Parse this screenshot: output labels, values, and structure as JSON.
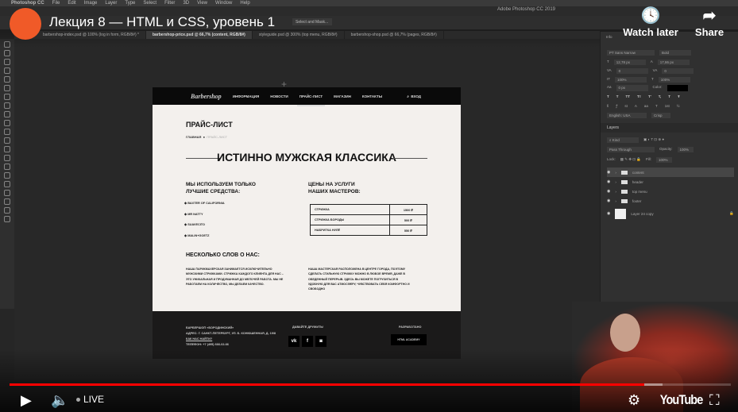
{
  "video": {
    "title": "Лекция 8 — HTML и CSS, уровень 1",
    "watch_later": "Watch later",
    "share": "Share",
    "live": "LIVE",
    "logo": "YouTube",
    "progress_percent": 88,
    "accent": "#ff0000",
    "avatar_color": "#f05a28"
  },
  "mac_menu": [
    "Photoshop CC",
    "File",
    "Edit",
    "Image",
    "Layer",
    "Type",
    "Select",
    "Filter",
    "3D",
    "View",
    "Window",
    "Help"
  ],
  "photoshop": {
    "app_title": "Adobe Photoshop CC 2019",
    "select_mask": "Select and Mask...",
    "tabs": [
      {
        "label": "barbershop-index.psd @ 100% (log in form, RGB/8#) *",
        "active": false
      },
      {
        "label": "barbershop-price.psd @ 66,7% (content, RGB/8#)",
        "active": true
      },
      {
        "label": "styleguide.psd @ 300% (top menu, RGB/8#)",
        "active": false
      },
      {
        "label": "barbershop-shop.psd @ 66,7% (pages, RGB/8#)",
        "active": false
      }
    ],
    "character": {
      "font": "PT Sans Narrow",
      "style": "Bold",
      "size": "12,78 px",
      "leading": "17,86 px",
      "kerning": "0",
      "tracking": "0",
      "vscale": "100%",
      "hscale": "100%",
      "baseline": "0 px",
      "color_label": "Color:",
      "language": "English: USA",
      "aa": "Crisp",
      "panel": "Info"
    },
    "layers": {
      "title": "Layers",
      "filter": "Kind",
      "blend": "Pass Through",
      "opacity_label": "Opacity:",
      "opacity": "100%",
      "lock_label": "Lock:",
      "fill_label": "Fill:",
      "fill": "100%",
      "items": [
        {
          "name": "content",
          "type": "folder",
          "selected": true
        },
        {
          "name": "header",
          "type": "folder"
        },
        {
          "name": "top menu",
          "type": "folder"
        },
        {
          "name": "footer",
          "type": "folder"
        },
        {
          "name": "Layer 24 copy",
          "type": "layer",
          "locked": true
        }
      ]
    }
  },
  "site": {
    "logo": "Barbershop",
    "nav": [
      {
        "label": "ИНФОРМАЦИЯ"
      },
      {
        "label": "НОВОСТИ"
      },
      {
        "label": "ПРАЙС-ЛИСТ",
        "active": true
      },
      {
        "label": "МАГАЗИН"
      },
      {
        "label": "КОНТАКТЫ"
      }
    ],
    "login": "ВХОД",
    "page_title": "ПРАЙС-ЛИСТ",
    "breadcrumb": [
      "ГЛАВНАЯ",
      "ПРАЙС-ЛИСТ"
    ],
    "headline": "ИСТИННО МУЖСКАЯ КЛАССИКА",
    "tools_title": [
      "МЫ ИСПОЛЬЗУЕМ ТОЛЬКО",
      "ЛУЧШИЕ СРЕДСТВА:"
    ],
    "tools": [
      "BAXTER OF CALIFORNIA",
      "MR NATTY",
      "SUAVECITO",
      "MALIN+GOETZ"
    ],
    "prices_title": [
      "ЦЕНЫ НА УСЛУГИ",
      "НАШИХ МАСТЕРОВ:"
    ],
    "prices": [
      {
        "service": "СТРИЖКА",
        "price": "1500 ₽"
      },
      {
        "service": "СТРИЖКА БОРОДЫ",
        "price": "500 ₽"
      },
      {
        "service": "НАБРИТКА НУЛЁ",
        "price": "550 ₽"
      }
    ],
    "about_title": "НЕСКОЛЬКО СЛОВ О НАС:",
    "about_left": "НАША ПАРИКМАХЕРСКАЯ ЗАНИМАЕТСЯ ИСКЛЮЧИТЕЛЬНО МУЖСКИМИ СТРИЖКАМИ. СТРИЖКА КАЖДОГО КЛИЕНТА ДЛЯ НАС – ЭТО УНИКАЛЬНАЯ И ПРОДУМАННАЯ ДО МЕЛОЧЕЙ РАБОТА. МЫ НЕ РАБОТАЕМ НА КОЛИЧЕСТВО, МЫ ДЕЛАЕМ КАЧЕСТВО.",
    "about_right": "НАША МАСТЕРСКАЯ РАСПОЛОЖЕНА В ЦЕНТРЕ ГОРОДА, ПОЭТОМУ СДЕЛАТЬ СТИЛЬНУЮ СТРИЖКУ МОЖНО В ЛЮБОЕ ВРЕМЯ, ДАЖЕ В ОБЕДЕННЫЙ ПЕРЕРЫВ. ЗДЕСЬ ВЫ МОЖЕТЕ ПОГРУЗИТЬСЯ В УДОБНУЮ ДЛЯ ВАС АТМОСФЕРУ, ЧУВСТВОВАТЬ СЕБЯ КОМФОРТНО И СВОБОДНО",
    "footer": {
      "name": "БАРБЕРШОП «БОРОДИНСКИЙ»",
      "address": "АДРЕС: Г. САНКТ-ПЕТЕРБУРГ, УЛ. Б. КОНЮШЕННАЯ, Д. 19/8",
      "how": "КАК НАС НАЙТИ?",
      "phone": "ТЕЛЕФОН: +7 (495) 666-02-66",
      "friends": "ДАВАЙТЕ ДРУЖИТЬ!",
      "social": [
        "vk",
        "f",
        "ig"
      ],
      "dev_label": "РАЗРАБОТАНО",
      "dev": "HTML ACADEMY"
    }
  }
}
